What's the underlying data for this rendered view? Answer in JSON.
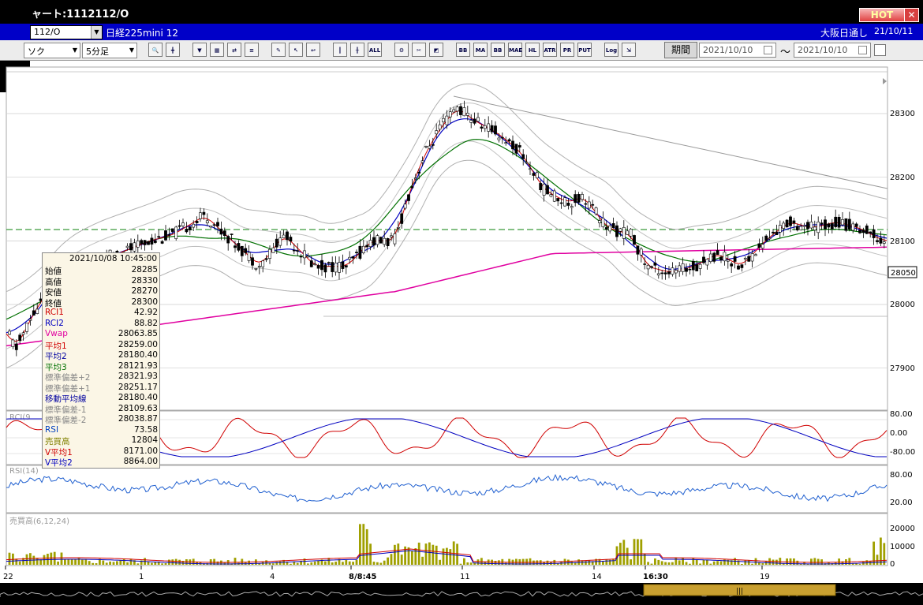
{
  "window": {
    "title": "ャート:1112112/O",
    "hot_label": "HOT",
    "close_label": "✕"
  },
  "toolbar1": {
    "code": "112/O",
    "product": "日経225mini 12",
    "market": "大阪日通し",
    "date": "21/10/11"
  },
  "toolbar2": {
    "type_select": "ソク",
    "interval_select": "5分足",
    "period_label": "期間",
    "date_from": "2021/10/10",
    "date_to": "2021/10/10",
    "tilde": "〜",
    "buttons": [
      {
        "name": "zoom-icon",
        "label": "🔍"
      },
      {
        "name": "crosshair-icon",
        "label": "╋"
      },
      {
        "name": "candle-down-icon",
        "label": "▼"
      },
      {
        "name": "chart-edit-icon",
        "label": "▦"
      },
      {
        "name": "chart-compare-icon",
        "label": "⇄"
      },
      {
        "name": "disabled-icon",
        "label": "≡"
      },
      {
        "name": "pen-icon",
        "label": "✎"
      },
      {
        "name": "cursor-icon",
        "label": "↖"
      },
      {
        "name": "undo-icon",
        "label": "↩"
      },
      {
        "name": "candle-icon",
        "label": "┃"
      },
      {
        "name": "bar-icon",
        "label": "╂"
      },
      {
        "name": "all-button",
        "label": "ALL"
      },
      {
        "name": "settings-icon",
        "label": "⚙"
      },
      {
        "name": "tool-icon",
        "label": "✂"
      },
      {
        "name": "palette-icon",
        "label": "◩"
      },
      {
        "name": "bb-icon",
        "label": "BB"
      },
      {
        "name": "ma-button",
        "label": "MA"
      },
      {
        "name": "bb-button",
        "label": "BB"
      },
      {
        "name": "mae-button",
        "label": "MAE"
      },
      {
        "name": "hl-button",
        "label": "HL"
      },
      {
        "name": "atr-button",
        "label": "ATR"
      },
      {
        "name": "pr-button",
        "label": "PR"
      },
      {
        "name": "put-button",
        "label": "PUT"
      },
      {
        "name": "log-button",
        "label": "Log"
      },
      {
        "name": "export-icon",
        "label": "⇲"
      }
    ]
  },
  "price_axis": {
    "labels": [
      "28300",
      "28200",
      "28100",
      "28050",
      "28000",
      "27900"
    ],
    "current": "28050"
  },
  "rci": {
    "label": "RCI(9",
    "axis": [
      "80.00",
      "0.00",
      "-80.00"
    ]
  },
  "rsi": {
    "label": "RSI(14)",
    "axis": [
      "80.00",
      "20.00"
    ]
  },
  "volume": {
    "label": "売買高(6,12,24)",
    "axis": [
      "20000",
      "10000",
      "0"
    ]
  },
  "x_axis": {
    "labels": [
      "22",
      "1",
      "4",
      "8/8:45",
      "11",
      "14",
      "16:30",
      "19"
    ]
  },
  "info_box": {
    "datetime": "2021/10/08  10:45:00",
    "rows": [
      {
        "k": "始値",
        "v": "28285",
        "c": "#000"
      },
      {
        "k": "高値",
        "v": "28330",
        "c": "#000"
      },
      {
        "k": "安値",
        "v": "28270",
        "c": "#000"
      },
      {
        "k": "終値",
        "v": "28300",
        "c": "#000"
      },
      {
        "k": "RCI1",
        "v": "42.92",
        "c": "#d00000"
      },
      {
        "k": "RCI2",
        "v": "88.82",
        "c": "#0000c0"
      },
      {
        "k": "Vwap",
        "v": "28063.85",
        "c": "#e000a0"
      },
      {
        "k": "平均1",
        "v": "28259.00",
        "c": "#d00000"
      },
      {
        "k": "平均2",
        "v": "28180.40",
        "c": "#0000a0"
      },
      {
        "k": "平均3",
        "v": "28121.93",
        "c": "#007000"
      },
      {
        "k": "標準偏差+2",
        "v": "28321.93",
        "c": "#888"
      },
      {
        "k": "標準偏差+1",
        "v": "28251.17",
        "c": "#888"
      },
      {
        "k": "移動平均線",
        "v": "28180.40",
        "c": "#0000a0"
      },
      {
        "k": "標準偏差-1",
        "v": "28109.63",
        "c": "#888"
      },
      {
        "k": "標準偏差-2",
        "v": "28038.87",
        "c": "#888"
      },
      {
        "k": "RSI",
        "v": "73.58",
        "c": "#0040c0"
      },
      {
        "k": "売買高",
        "v": "12804",
        "c": "#808000"
      },
      {
        "k": "V平均1",
        "v": "8171.00",
        "c": "#d00000"
      },
      {
        "k": "V平均2",
        "v": "8864.00",
        "c": "#0000c0"
      }
    ]
  },
  "colors": {
    "accent": "#0000c8",
    "candle_up": "#ffffff",
    "candle_down": "#000000",
    "ma1": "#d00000",
    "ma2": "#0000c0",
    "ma3": "#007000",
    "vwap": "#e000a0",
    "bands": "#999999",
    "volume": "#a0a000"
  }
}
